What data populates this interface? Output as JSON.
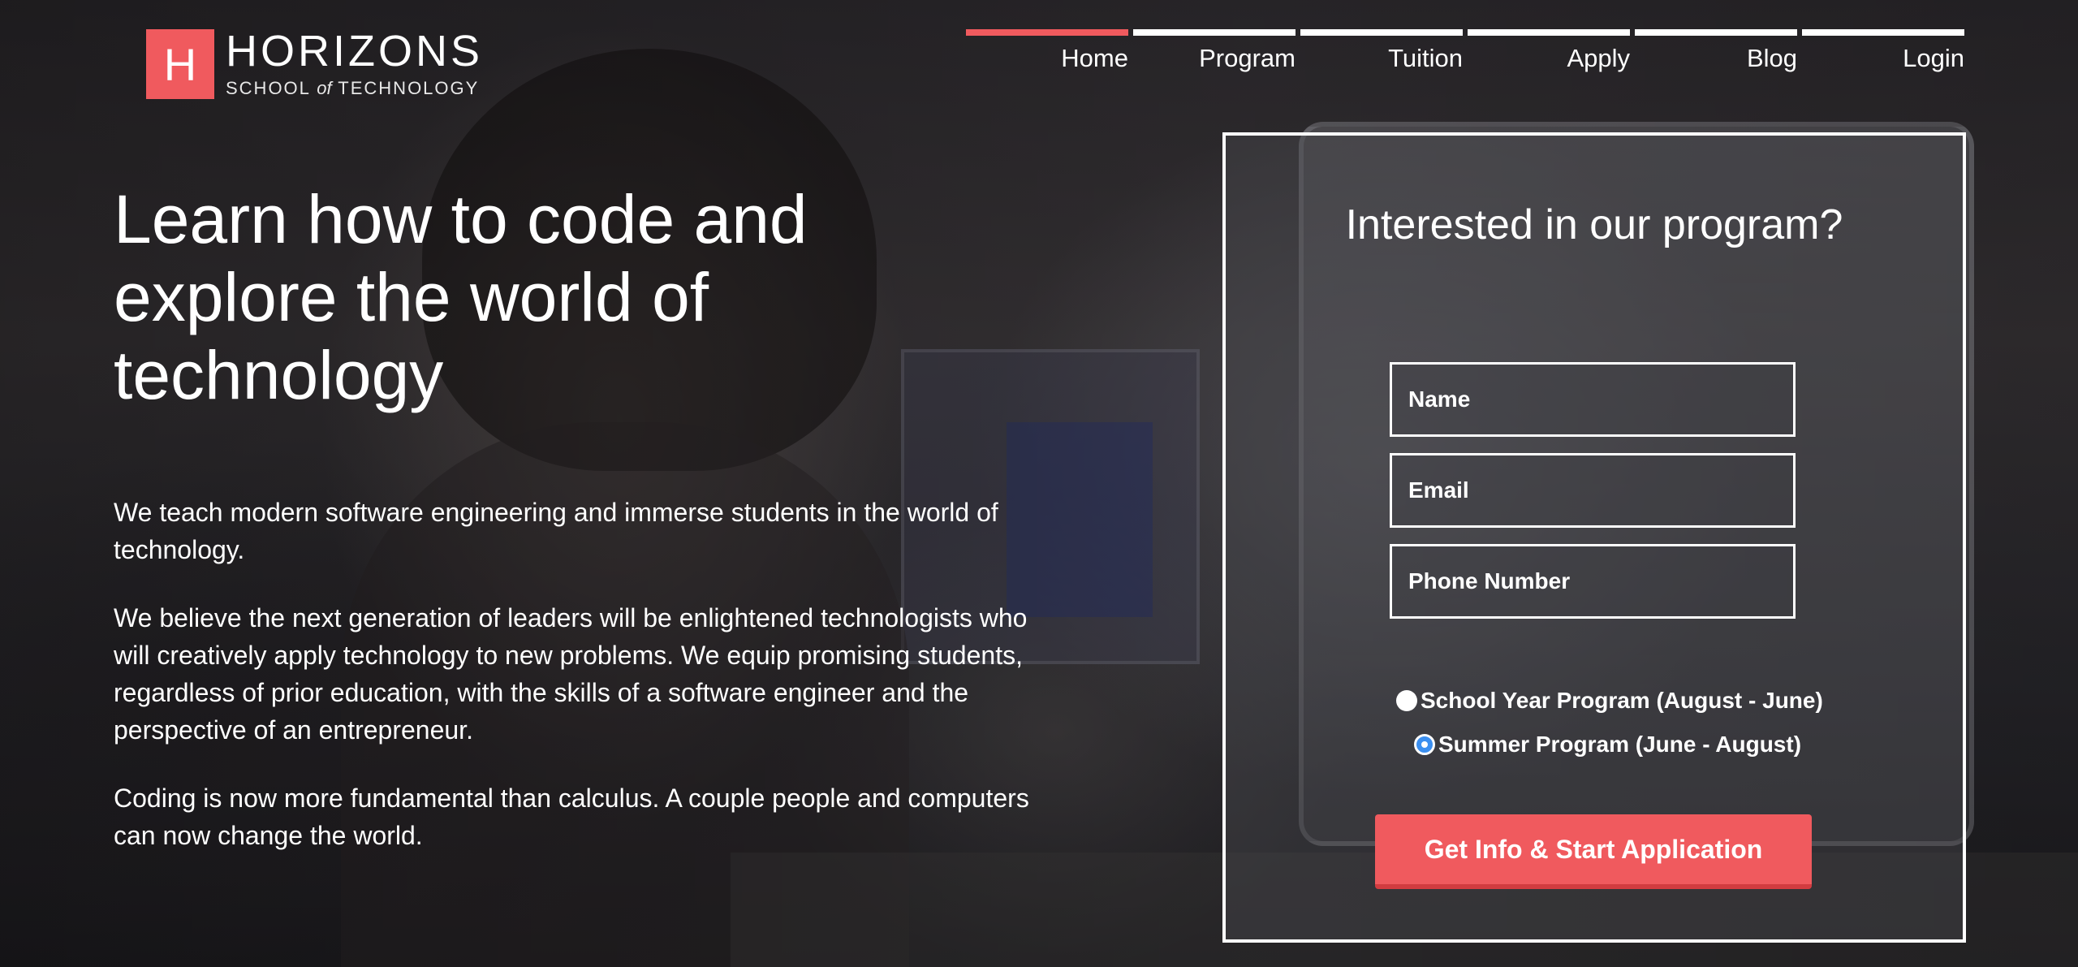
{
  "brand": {
    "mark": "H",
    "name": "HORIZONS",
    "subtitle_pre": "SCHOOL ",
    "subtitle_of": "of",
    "subtitle_post": " TECHNOLOGY",
    "accent_color": "#f05a5e"
  },
  "nav": {
    "items": [
      {
        "label": "Home",
        "active": true
      },
      {
        "label": "Program",
        "active": false
      },
      {
        "label": "Tuition",
        "active": false
      },
      {
        "label": "Apply",
        "active": false
      },
      {
        "label": "Blog",
        "active": false
      },
      {
        "label": "Login",
        "active": false
      }
    ]
  },
  "hero": {
    "title": "Learn how to code and explore the world of technology",
    "paragraphs": [
      "We teach modern software engineering and immerse students in the world of technology.",
      "We believe the next generation of leaders will be enlightened technologists who will creatively apply technology to new problems. We equip promising students, regardless of prior education, with the skills of a software engineer and the perspective of an entrepreneur.",
      "Coding is now more fundamental than calculus. A couple people and computers can now change the world."
    ]
  },
  "form": {
    "title": "Interested in our program?",
    "name_placeholder": "Name",
    "email_placeholder": "Email",
    "phone_placeholder": "Phone Number",
    "options": [
      {
        "label": "School Year Program (August - June)",
        "checked": false
      },
      {
        "label": "Summer Program (June - August)",
        "checked": true
      }
    ],
    "submit_label": "Get Info & Start Application",
    "radio_checked_color": "#3b8ff0"
  }
}
